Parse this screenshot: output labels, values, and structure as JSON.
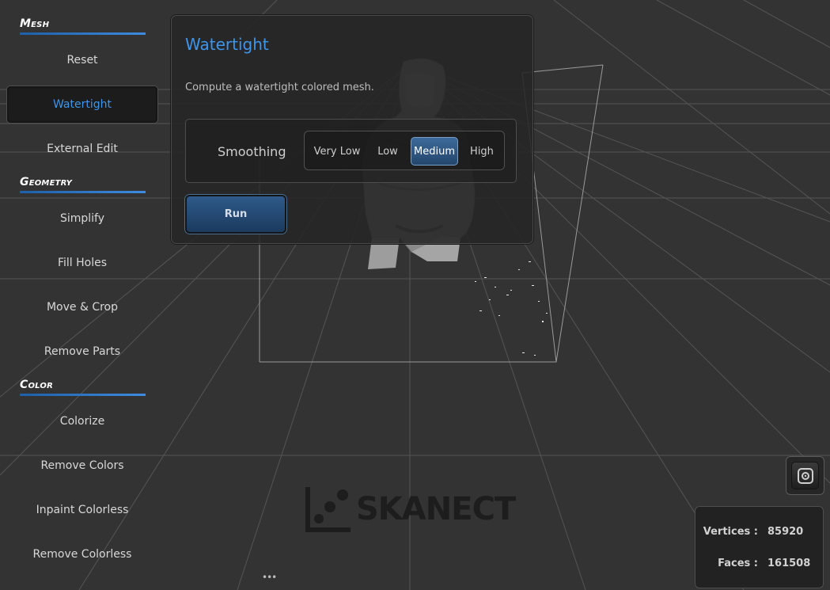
{
  "sidebar": {
    "sections": [
      {
        "title": "Mesh",
        "items": [
          "Reset",
          "Watertight",
          "External Edit"
        ]
      },
      {
        "title": "Geometry",
        "items": [
          "Simplify",
          "Fill Holes",
          "Move & Crop",
          "Remove Parts"
        ]
      },
      {
        "title": "Color",
        "items": [
          "Colorize",
          "Remove Colors",
          "Inpaint Colorless",
          "Remove Colorless"
        ]
      }
    ],
    "active_item": "Watertight"
  },
  "dialog": {
    "title": "Watertight",
    "description": "Compute a watertight colored mesh.",
    "smoothing": {
      "label": "Smoothing",
      "options": [
        "Very Low",
        "Low",
        "Medium",
        "High"
      ],
      "selected": "Medium"
    },
    "run_label": "Run"
  },
  "logo": {
    "text": "SKANECT"
  },
  "stats": {
    "vertices_label": "Vertices :",
    "vertices_value": "85920",
    "faces_label": "Faces :",
    "faces_value": "161508"
  },
  "colors": {
    "accent": "#3d95ec",
    "background": "#333333",
    "selected_button": "#2f5a8a"
  },
  "icons": {
    "camera": "camera-icon",
    "drag": "ellipsis-icon"
  }
}
